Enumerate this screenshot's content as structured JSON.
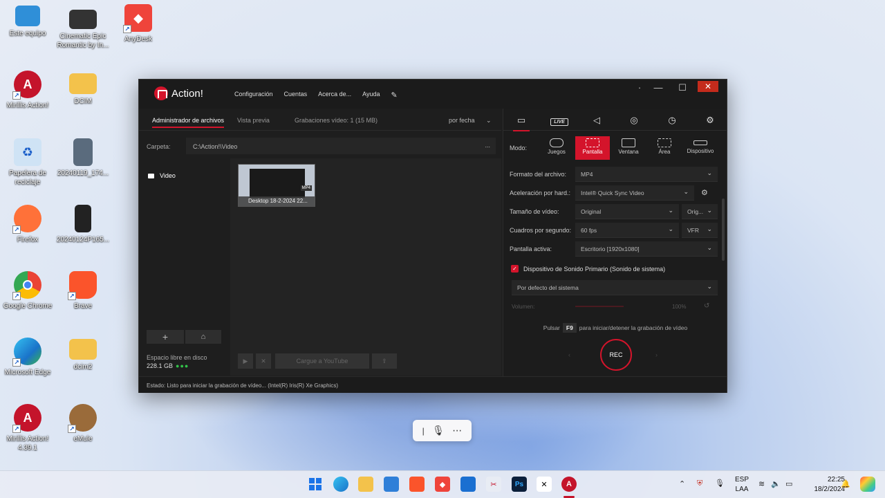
{
  "desktop": {
    "icons": [
      {
        "label": "Este equipo",
        "color": "#2f8fd8",
        "glyph": "🖥"
      },
      {
        "label": "Cinematic Epic Romantic by In...",
        "color": "#333",
        "glyph": "🎬"
      },
      {
        "label": "AnyDesk",
        "color": "#ef443b",
        "glyph": "◆"
      },
      {
        "label": "Mirillis Action!",
        "color": "#c4142b",
        "glyph": "A"
      },
      {
        "label": "DCIM",
        "color": "#f3c24b",
        "glyph": ""
      },
      {
        "label": "Papelera de reciclaje",
        "color": "#9fc5e8",
        "glyph": "♻"
      },
      {
        "label": "20240119_174...",
        "color": "#5a6b7d",
        "glyph": ""
      },
      {
        "label": "Firefox",
        "color": "#ff7139",
        "glyph": "🦊"
      },
      {
        "label": "20240124P165...",
        "color": "#222",
        "glyph": ""
      },
      {
        "label": "Google Chrome",
        "color": "#4285f4",
        "glyph": "◉"
      },
      {
        "label": "Brave",
        "color": "#fb542b",
        "glyph": "🦁"
      },
      {
        "label": "Microsoft Edge",
        "color": "#1ba1e2",
        "glyph": "e"
      },
      {
        "label": "dcim2",
        "color": "#f3c24b",
        "glyph": ""
      },
      {
        "label": "Mirillis Action! 4.39.1",
        "color": "#c4142b",
        "glyph": "A"
      },
      {
        "label": "eMule",
        "color": "#9a6b3a",
        "glyph": "🫏"
      }
    ]
  },
  "window": {
    "app_name": "Action!",
    "menu": [
      "Configuración",
      "Cuentas",
      "Acerca de...",
      "Ayuda"
    ],
    "controls": {
      "minimize": "—",
      "maximize": "☐",
      "close": "✕"
    },
    "left_tabs": {
      "files": "Administrador de archivos",
      "preview": "Vista previa",
      "recordings": "Grabaciones vídeo: 1 (15 MB)",
      "sort": "por fecha"
    },
    "folder": {
      "label": "Carpeta:",
      "path": "C:\\Action!\\Video",
      "more": "..."
    },
    "tree": {
      "video": "Video"
    },
    "thumbnail": {
      "caption": "Desktop 18-2-2024 22...",
      "badge": "MP4"
    },
    "disk": {
      "label": "Espacio libre en disco",
      "value": "228.1 GB",
      "leds": "●●●"
    },
    "buttons": {
      "add": "+",
      "folder": "⌂",
      "play": "▶",
      "delete": "✕",
      "youtube": "Cargue a YouTube",
      "upload": "⇪"
    },
    "status": "Estado:  Listo para iniciar la grabación de vídeo...  (Intel(R) Iris(R) Xe Graphics)"
  },
  "right_panel": {
    "tabs": [
      "▭",
      "LIVE",
      "◁",
      "◎",
      "◷",
      "⚙"
    ],
    "mode_label": "Modo:",
    "modes": [
      "Juegos",
      "Pantalla",
      "Ventana",
      "Área",
      "Dispositivo"
    ],
    "settings": {
      "format": {
        "label": "Formato del archivo:",
        "value": "MP4"
      },
      "accel": {
        "label": "Aceleración por hard.:",
        "value": "Intel® Quick Sync Video"
      },
      "size": {
        "label": "Tamaño de vídeo:",
        "value": "Original",
        "extra": "Orig..."
      },
      "fps": {
        "label": "Cuadros por segundo:",
        "value": "60 fps",
        "extra": "VFR"
      },
      "screen": {
        "label": "Pantalla activa:",
        "value": "Escritorio [1920x1080]"
      }
    },
    "audio": {
      "label": "Dispositivo de Sonido Primario (Sonido de sistema)",
      "device": "Por defecto del sistema",
      "volume_label": "Volumen:",
      "volume_value": "100%"
    },
    "hint": {
      "pre": "Pulsar",
      "key": "F9",
      "post": "para iniciar/detener la grabación de vídeo"
    },
    "rec": "REC"
  },
  "taskbar": {
    "lang": [
      "ESP",
      "LAA"
    ],
    "time": "22:25",
    "date": "18/2/2024"
  },
  "colors": {
    "accent": "#d4142b"
  }
}
